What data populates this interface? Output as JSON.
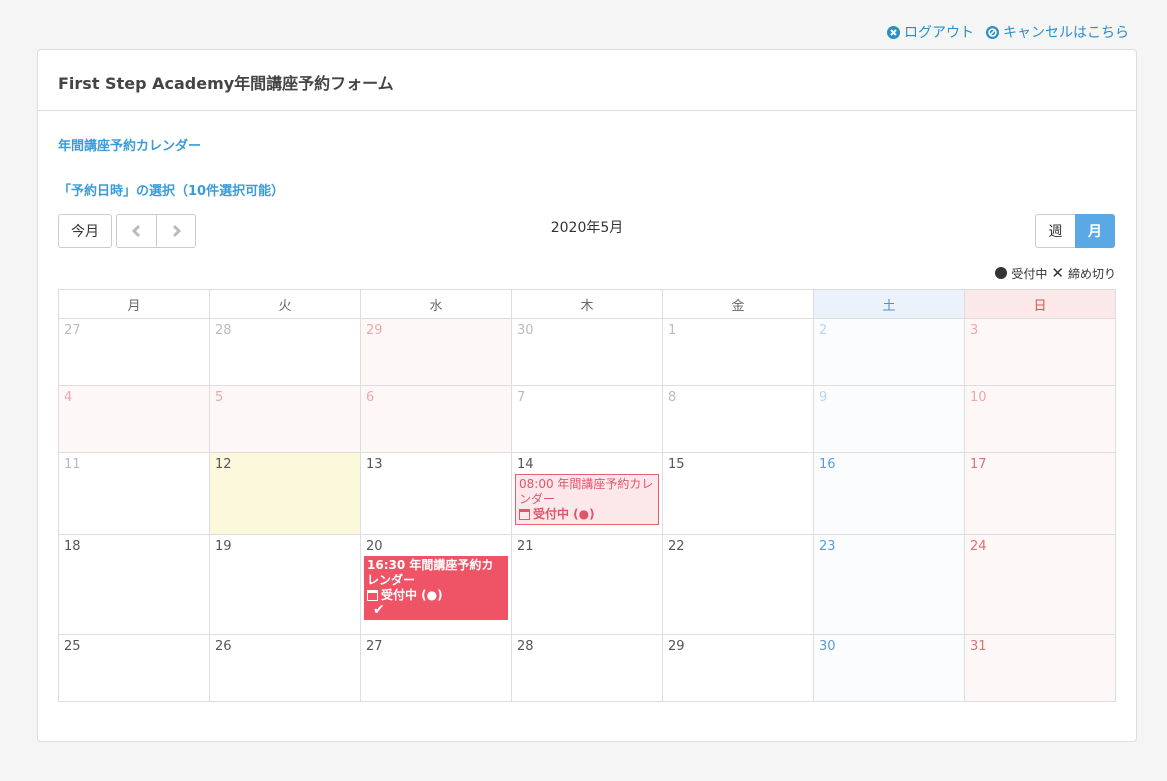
{
  "header": {
    "logout": "ログアウト",
    "cancel": "キャンセルはこちら"
  },
  "panel": {
    "title": "First Step Academy年間講座予約フォーム",
    "calendar_title": "年間講座予約カレンダー",
    "select_title": "「予約日時」の選択（10件選択可能）"
  },
  "toolbar": {
    "today": "今月",
    "month_label": "2020年5月",
    "week": "週",
    "month": "月"
  },
  "legend": {
    "open": "受付中",
    "closed": "締め切り"
  },
  "weekdays": [
    "月",
    "火",
    "水",
    "木",
    "金",
    "土",
    "日"
  ],
  "weeks": [
    [
      "27",
      "28",
      "29",
      "30",
      "1",
      "2",
      "3"
    ],
    [
      "4",
      "5",
      "6",
      "7",
      "8",
      "9",
      "10"
    ],
    [
      "11",
      "12",
      "13",
      "14",
      "15",
      "16",
      "17"
    ],
    [
      "18",
      "19",
      "20",
      "21",
      "22",
      "23",
      "24"
    ],
    [
      "25",
      "26",
      "27",
      "28",
      "29",
      "30",
      "31"
    ]
  ],
  "events": {
    "e14": {
      "title": "08:00 年間講座予約カレンダー",
      "status": "受付中 (●)"
    },
    "e20": {
      "title": "16:30 年間講座予約カレンダー",
      "status": "受付中 (●)",
      "check": "✔"
    }
  },
  "colors": {
    "accent": "#3b9bd8",
    "event": "#ee5466",
    "today": "#fcf8dc"
  }
}
